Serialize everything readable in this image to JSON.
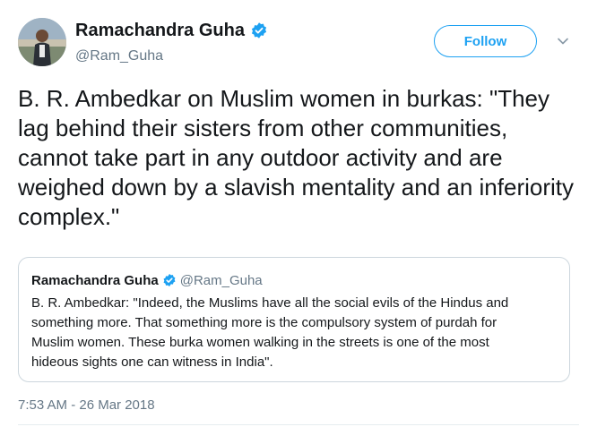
{
  "author": {
    "name": "Ramachandra Guha",
    "handle": "@Ram_Guha",
    "verified": true
  },
  "actions": {
    "follow_label": "Follow",
    "menu_icon": "chevron-down-icon"
  },
  "tweet": {
    "text": "B. R. Ambedkar on Muslim women in burkas: \"They lag behind their sisters from other communities, cannot take part in any outdoor activity and are weighed down by a slavish mentality and an inferiority complex.\"",
    "timestamp": "7:53 AM - 26 Mar 2018"
  },
  "quoted_tweet": {
    "name": "Ramachandra Guha",
    "handle": "@Ram_Guha",
    "verified": true,
    "text": "B. R. Ambedkar: \"Indeed, the Muslims have all the social evils of the Hindus and\nsomething  more. That something more is the compulsory system of purdah for\nMuslim women. These burka women walking in the streets is one of the most\nhideous sights one can witness in India\"."
  },
  "colors": {
    "accent": "#1da1f2",
    "text_primary": "#14171a",
    "text_secondary": "#657786",
    "border": "#ccd6dd"
  }
}
